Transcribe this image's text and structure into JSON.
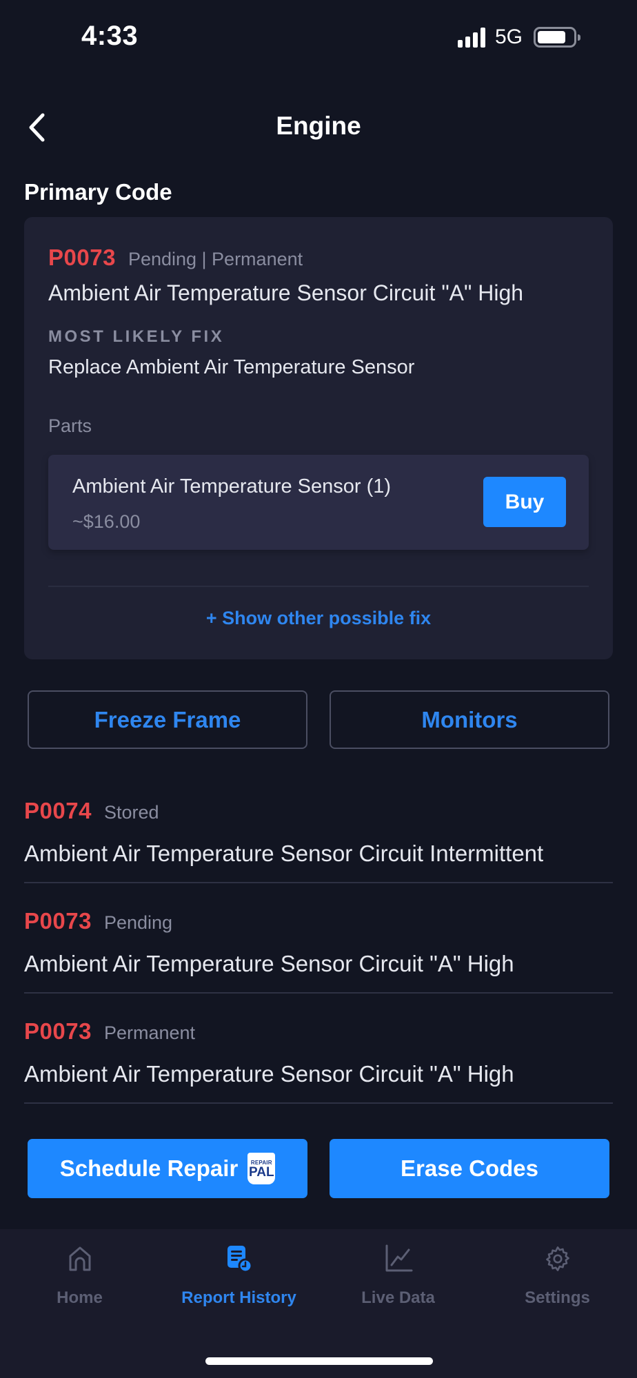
{
  "status_bar": {
    "time": "4:33",
    "network": "5G",
    "signal_bars": 4,
    "battery_level_percent": 80
  },
  "nav": {
    "title": "Engine",
    "back_icon": "chevron-left-icon"
  },
  "primary_section": {
    "label": "Primary Code",
    "code": "P0073",
    "status": "Pending | Permanent",
    "description": "Ambient Air Temperature Sensor Circuit \"A\" High",
    "fix_label": "MOST LIKELY FIX",
    "fix_text": "Replace Ambient Air Temperature Sensor",
    "parts_label": "Parts",
    "part": {
      "name": "Ambient Air Temperature Sensor (1)",
      "price": "~$16.00",
      "buy_label": "Buy"
    },
    "show_other_label": "+ Show other possible fix"
  },
  "actions": {
    "freeze_frame_label": "Freeze Frame",
    "monitors_label": "Monitors",
    "schedule_repair_label": "Schedule Repair",
    "schedule_badge_top": "REPAIR",
    "schedule_badge_main": "PAL",
    "erase_codes_label": "Erase Codes"
  },
  "codes": [
    {
      "code": "P0074",
      "status": "Stored",
      "description": "Ambient Air Temperature Sensor Circuit Intermittent"
    },
    {
      "code": "P0073",
      "status": "Pending",
      "description": "Ambient Air Temperature Sensor Circuit \"A\" High"
    },
    {
      "code": "P0073",
      "status": "Permanent",
      "description": "Ambient Air Temperature Sensor Circuit \"A\" High"
    }
  ],
  "tab_bar": {
    "active_index": 1,
    "tabs": [
      {
        "label": "Home",
        "icon": "home-icon"
      },
      {
        "label": "Report History",
        "icon": "report-history-icon"
      },
      {
        "label": "Live Data",
        "icon": "chart-line-icon"
      },
      {
        "label": "Settings",
        "icon": "gear-icon"
      }
    ]
  },
  "colors": {
    "background": "#121522",
    "card": "#1f2133",
    "part_card": "#2b2c45",
    "accent_blue": "#1e88ff",
    "link_blue": "#2f86ef",
    "code_red": "#e8474b",
    "muted_text": "#8a8da0",
    "tab_inactive": "#5c5f74"
  }
}
